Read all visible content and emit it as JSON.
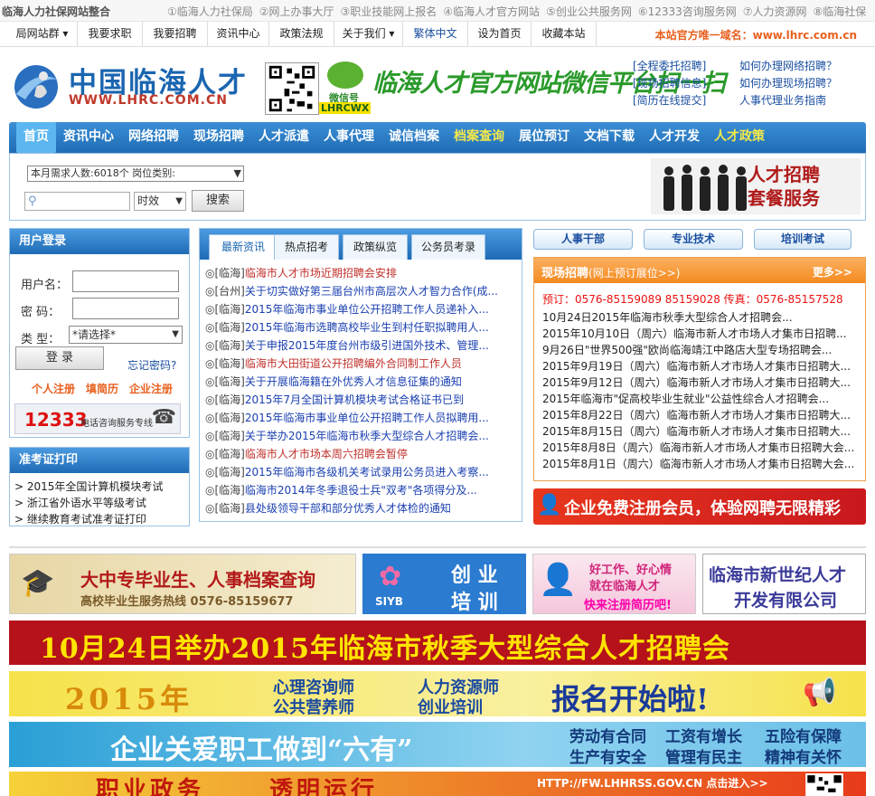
{
  "topbar": {
    "title": "临海人力社保网站整合",
    "links": [
      "①临海人力社保局",
      "②网上办事大厅",
      "③职业技能网上报名",
      "④临海人才官方网站",
      "⑤创业公共服务网",
      "⑥12333咨询服务网",
      "⑦人力资源网",
      "⑧临海社保"
    ]
  },
  "nav2": {
    "items": [
      "局网站群",
      "我要求职",
      "我要招聘",
      "资讯中心",
      "政策法规",
      "关于我们",
      "繁体中文",
      "设为首页",
      "收藏本站"
    ],
    "official": "本站官方唯一域名：www.lhrc.com.cn"
  },
  "logo": {
    "cn": "中国临海人才",
    "en": "WWW.LHRC.COM.CN"
  },
  "wechat": {
    "label": "微信号",
    "id": "LHRCWX",
    "slogan": "临海人才官方网站微信平台扫一扫"
  },
  "quicklinks": {
    "left": [
      "[全程委托招聘]",
      "[现场招聘信息]",
      "[简历在线提交]"
    ],
    "right": [
      "如何办理网络招聘？",
      "如何办理现场招聘？",
      "人事代理业务指南"
    ]
  },
  "mainnav": [
    "首页",
    "资讯中心",
    "网络招聘",
    "现场招聘",
    "人才派遣",
    "人事代理",
    "诚信档案",
    "档案查询",
    "展位预订",
    "文档下载",
    "人才开发",
    "人才政策"
  ],
  "search": {
    "demand": "本月需求人数:6018个  岗位类别:",
    "time": "时效",
    "button": "搜索",
    "banner": [
      "人才招聘",
      "套餐服务"
    ]
  },
  "login": {
    "title": "用户登录",
    "user": "用户名：",
    "pass": "密  码：",
    "type": "类  型：",
    "type_value": "*请选择*",
    "button": "登  录",
    "forgot": "忘记密码?",
    "links": [
      "个人注册",
      "填简历",
      "企业注册"
    ],
    "hotline": "12333",
    "hotline_text": "电话咨询服务专线"
  },
  "exam": {
    "title": "准考证打印",
    "items": [
      "> 2015年全国计算机模块考试",
      "> 浙江省外语水平等级考试",
      "> 继续教育考试准考证打印"
    ]
  },
  "news": {
    "tabs": [
      "最新资讯",
      "热点招考",
      "政策纵览",
      "公务员考录"
    ],
    "items": [
      {
        "tag": "◎[临海]",
        "title": "临海市人才市场近期招聘会安排",
        "red": true
      },
      {
        "tag": "◎[台州]",
        "title": "关于切实做好第三届台州市高层次人才智力合作(成...",
        "red": false
      },
      {
        "tag": "◎[临海]",
        "title": "2015年临海市事业单位公开招聘工作人员递补入...",
        "red": false
      },
      {
        "tag": "◎[临海]",
        "title": "2015年临海市选聘高校毕业生到村任职拟聘用人...",
        "red": false
      },
      {
        "tag": "◎[临海]",
        "title": "关于申报2015年度台州市级引进国外技术、管理...",
        "red": false
      },
      {
        "tag": "◎[临海]",
        "title": "临海市大田街道公开招聘编外合同制工作人员",
        "red": true
      },
      {
        "tag": "◎[临海]",
        "title": "关于开展临海籍在外优秀人才信息征集的通知",
        "red": false
      },
      {
        "tag": "◎[临海]",
        "title": "2015年7月全国计算机模块考试合格证书已到",
        "red": false
      },
      {
        "tag": "◎[临海]",
        "title": "2015年临海市事业单位公开招聘工作人员拟聘用...",
        "red": false
      },
      {
        "tag": "◎[临海]",
        "title": "关于举办2015年临海市秋季大型综合人才招聘会...",
        "red": false
      },
      {
        "tag": "◎[临海]",
        "title": "临海市人才市场本周六招聘会暂停",
        "red": true
      },
      {
        "tag": "◎[临海]",
        "title": "2015年临海市各级机关考试录用公务员进入考察...",
        "red": false
      },
      {
        "tag": "◎[临海]",
        "title": "临海市2014年冬季退役士兵\"双考\"各项得分及...",
        "red": false
      },
      {
        "tag": "◎[临海]",
        "title": "县处级领导干部和部分优秀人才体检的通知",
        "red": false
      }
    ]
  },
  "rbtns": [
    "人事干部",
    "专业技术",
    "培训考试"
  ],
  "fair": {
    "title": "现场招聘",
    "sub": "(网上预订展位>>)",
    "more": "更多>>",
    "phone": "预订：0576-85159089 85159028 传真：0576-85157528",
    "items": [
      "10月24日2015年临海市秋季大型综合人才招聘会...",
      "2015年10月10日（周六）临海市新人才市场人才集市日招聘...",
      "9月26日\"世界500强\"欧尚临海靖江中路店大型专场招聘会...",
      "2015年9月19日（周六）临海市新人才市场人才集市日招聘大...",
      "2015年9月12日（周六）临海市新人才市场人才集市日招聘大...",
      "2015年临海市\"促高校毕业生就业\"公益性综合人才招聘会...",
      "2015年8月22日（周六）临海市新人才市场人才集市日招聘大...",
      "2015年8月15日（周六）临海市新人才市场人才集市日招聘大...",
      "2015年8月8日（周六）临海市新人才市场人才集市日招聘大会...",
      "2015年8月1日（周六）临海市新人才市场人才集市日招聘大会..."
    ]
  },
  "corp_banner": "企业免费注册会员，体验网聘无限精彩",
  "ads": {
    "archive": [
      "大中专毕业生、人事档案查询",
      "高校毕业生服务热线 0576-85159677"
    ],
    "siyb": [
      "创 业",
      "培 训",
      "SIYB"
    ],
    "job": [
      "好工作、好心情",
      "就在临海人才",
      "快来注册简历吧!"
    ],
    "century": [
      "临海市新世纪人才",
      "开发有限公司"
    ],
    "fair_banner": "10月24日举办2015年临海市秋季大型综合人才招聘会",
    "train": [
      "2015年",
      "心理咨询师",
      "公共营养师",
      "人力资源师",
      "创业培训",
      "报名开始啦!"
    ],
    "care": [
      "企业关爱职工做到“六有”",
      "劳动有合同",
      "工资有增长",
      "五险有保障",
      "生产有安全",
      "管理有民主",
      "精神有关怀"
    ],
    "bottom": [
      "职业政务",
      "透明运行",
      "HTTP://FW.LHHRSS.GOV.CN 点击进入>>"
    ]
  }
}
